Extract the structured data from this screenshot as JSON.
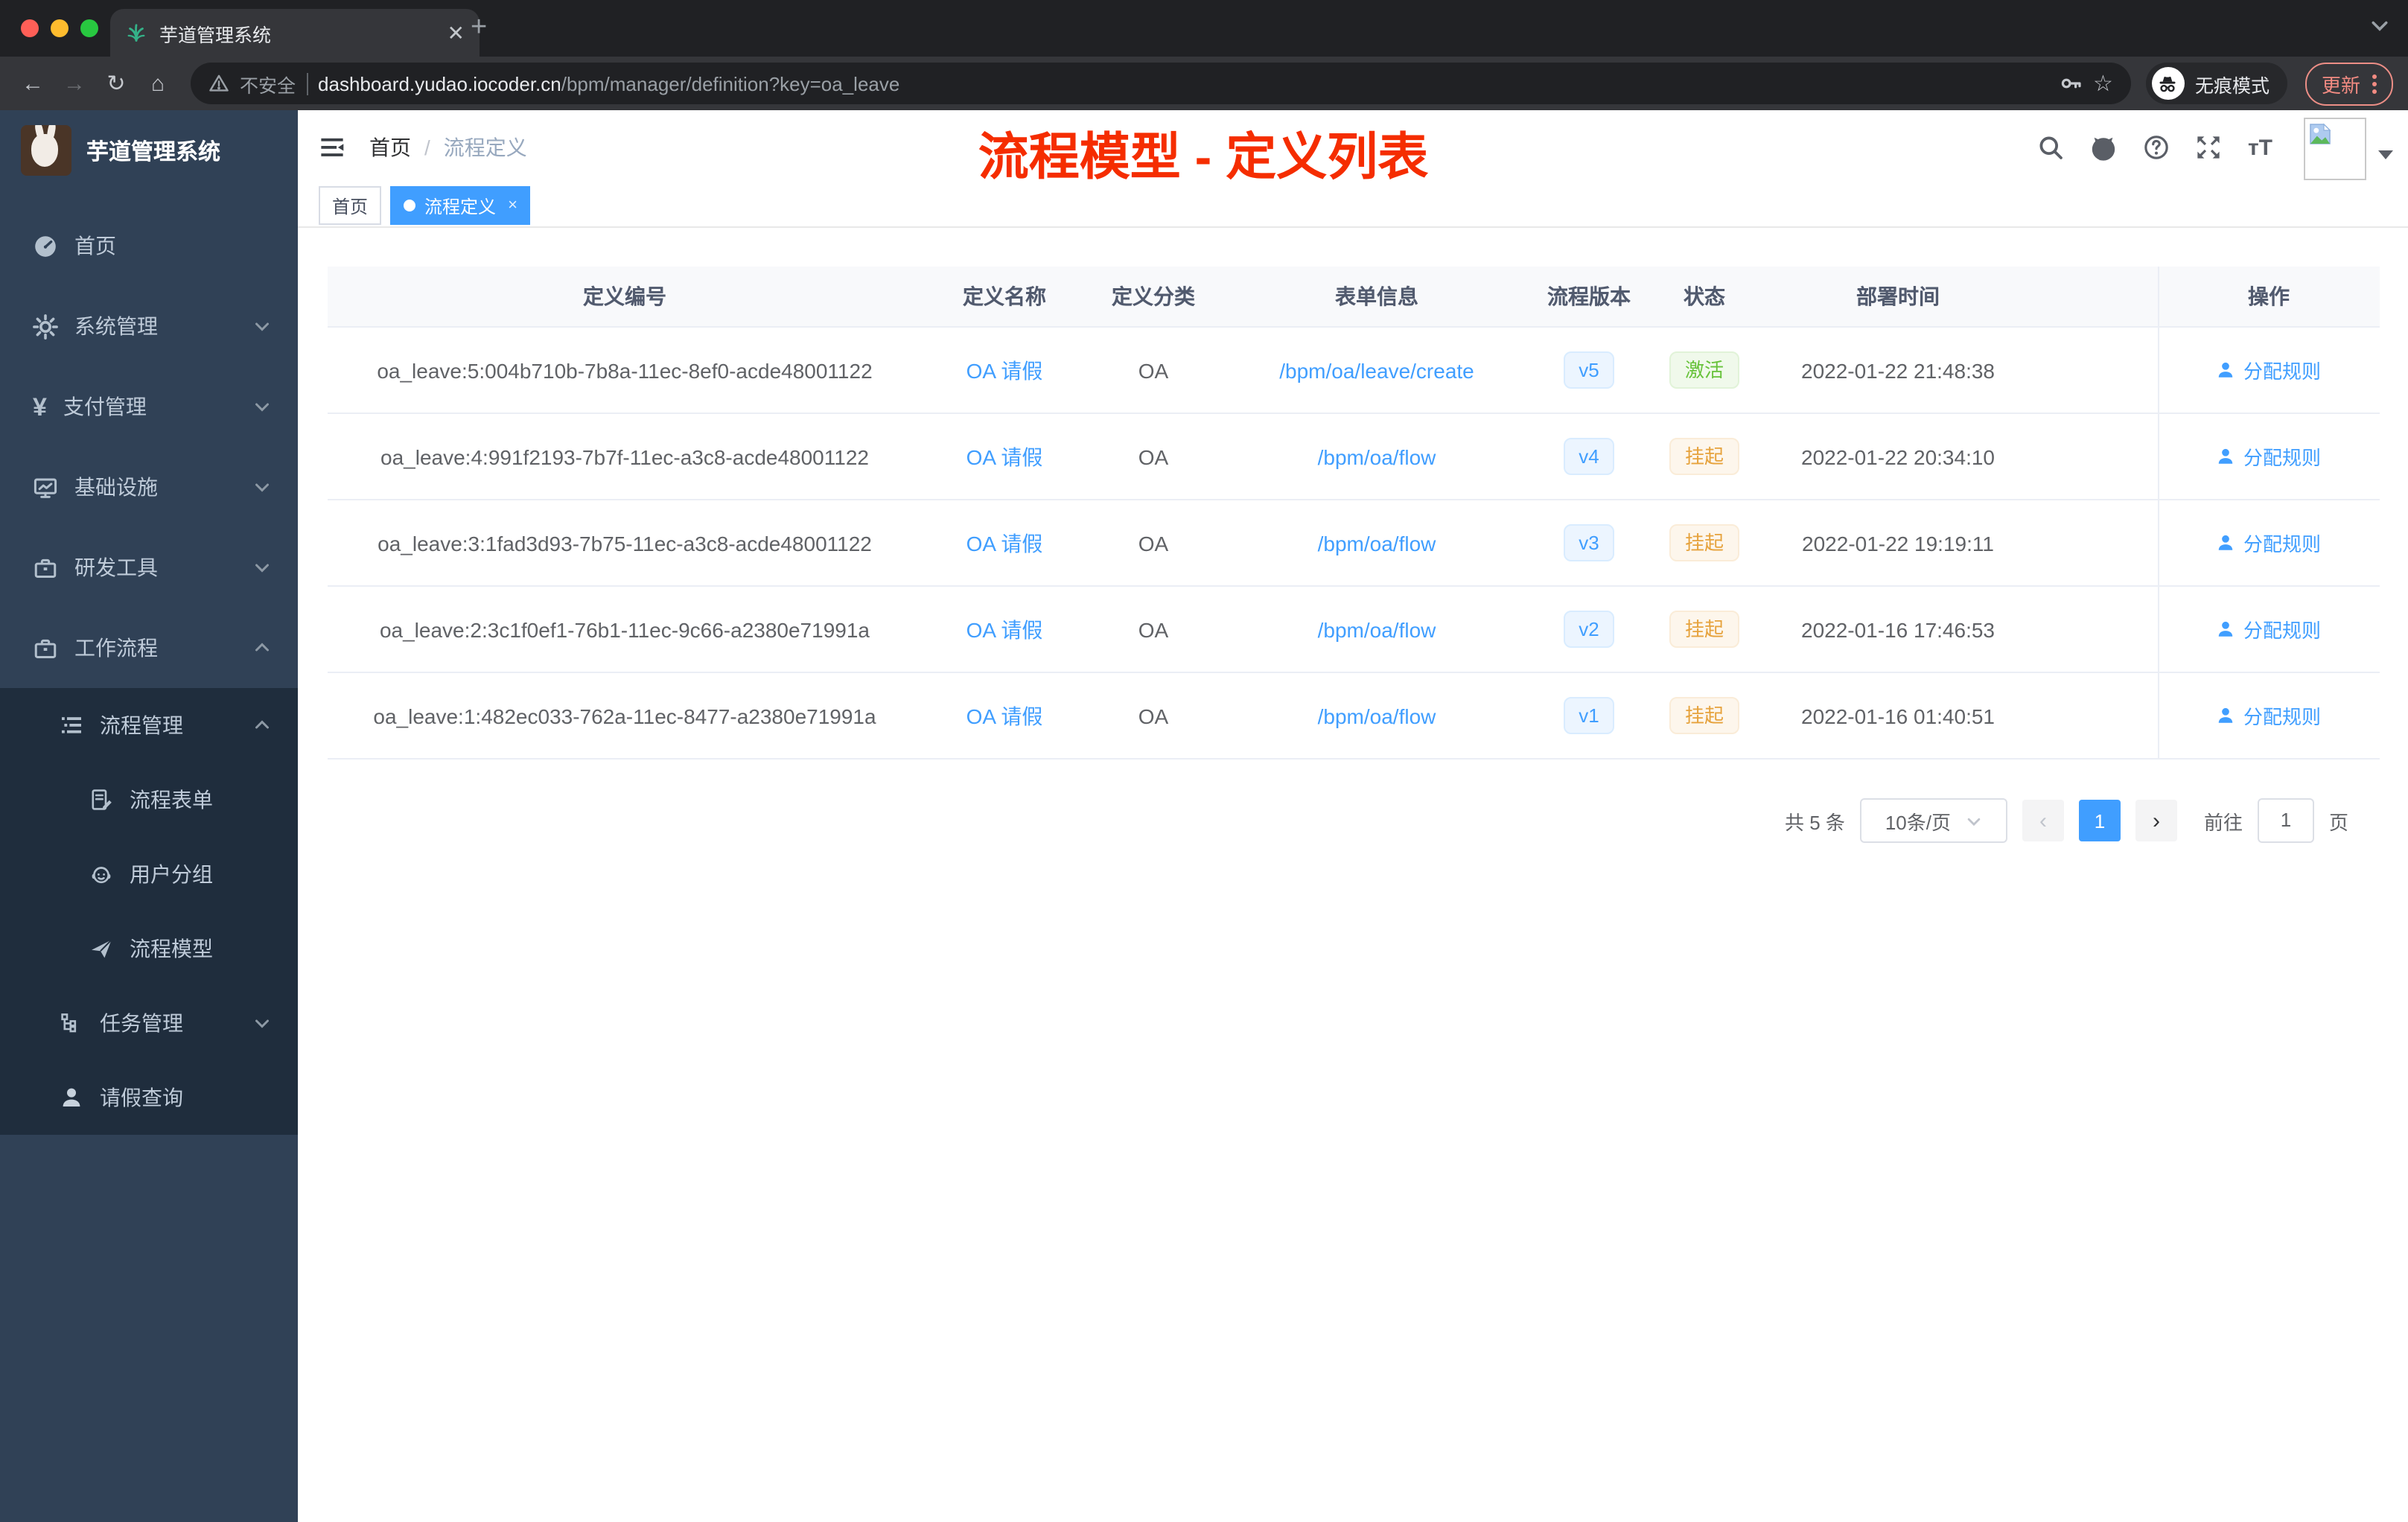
{
  "browser": {
    "tab_title": "芋道管理系统",
    "new_tab": "+",
    "tab_close": "✕",
    "back": "←",
    "forward": "→",
    "reload": "↻",
    "home": "⌂",
    "url_security": "不安全",
    "url_host": "dashboard.yudao.iocoder.cn",
    "url_path": "/bpm/manager/definition?key=oa_leave",
    "star": "☆",
    "incognito_label": "无痕模式",
    "update_label": "更新"
  },
  "sidebar": {
    "title": "芋道管理系统",
    "menu": [
      {
        "label": "首页",
        "icon": "dashboard-icon"
      },
      {
        "label": "系统管理",
        "icon": "gear-icon"
      },
      {
        "label": "支付管理",
        "icon": "yen-icon",
        "glyph": "¥"
      },
      {
        "label": "基础设施",
        "icon": "monitor-icon"
      },
      {
        "label": "研发工具",
        "icon": "toolbox-icon"
      },
      {
        "label": "工作流程",
        "icon": "briefcase-icon"
      }
    ],
    "workflow": {
      "process_mgmt": "流程管理",
      "children": [
        "流程表单",
        "用户分组",
        "流程模型"
      ],
      "task_mgmt": "任务管理",
      "leave_query": "请假查询"
    }
  },
  "header": {
    "breadcrumb": {
      "home": "首页",
      "sep": "/",
      "current": "流程定义"
    },
    "annotation": "流程模型 - 定义列表"
  },
  "tags": {
    "home": "首页",
    "active": "流程定义",
    "close": "×"
  },
  "table": {
    "columns": [
      "定义编号",
      "定义名称",
      "定义分类",
      "表单信息",
      "流程版本",
      "状态",
      "部署时间",
      "操作"
    ],
    "rows": [
      {
        "id": "oa_leave:5:004b710b-7b8a-11ec-8ef0-acde48001122",
        "name": "OA 请假",
        "category": "OA",
        "form": "/bpm/oa/leave/create",
        "version": "v5",
        "status": "激活",
        "deployed": "2022-01-22 21:48:38",
        "action": "分配规则"
      },
      {
        "id": "oa_leave:4:991f2193-7b7f-11ec-a3c8-acde48001122",
        "name": "OA 请假",
        "category": "OA",
        "form": "/bpm/oa/flow",
        "version": "v4",
        "status": "挂起",
        "deployed": "2022-01-22 20:34:10",
        "action": "分配规则"
      },
      {
        "id": "oa_leave:3:1fad3d93-7b75-11ec-a3c8-acde48001122",
        "name": "OA 请假",
        "category": "OA",
        "form": "/bpm/oa/flow",
        "version": "v3",
        "status": "挂起",
        "deployed": "2022-01-22 19:19:11",
        "action": "分配规则"
      },
      {
        "id": "oa_leave:2:3c1f0ef1-76b1-11ec-9c66-a2380e71991a",
        "name": "OA 请假",
        "category": "OA",
        "form": "/bpm/oa/flow",
        "version": "v2",
        "status": "挂起",
        "deployed": "2022-01-16 17:46:53",
        "action": "分配规则"
      },
      {
        "id": "oa_leave:1:482ec033-762a-11ec-8477-a2380e71991a",
        "name": "OA 请假",
        "category": "OA",
        "form": "/bpm/oa/flow",
        "version": "v1",
        "status": "挂起",
        "deployed": "2022-01-16 01:40:51",
        "action": "分配规则"
      }
    ]
  },
  "pagination": {
    "total": "共 5 条",
    "page_size": "10条/页",
    "prev": "‹",
    "next": "›",
    "current_page": "1",
    "goto_label": "前往",
    "goto_value": "1",
    "page_unit": "页"
  },
  "colors": {
    "primary": "#409EFF",
    "success": "#67C23A",
    "warning": "#E6A23C",
    "annotation_red": "#F52D00",
    "sidebar_bg": "#304156",
    "submenu_bg": "#1F2D3D",
    "chrome_dark": "#202124"
  }
}
